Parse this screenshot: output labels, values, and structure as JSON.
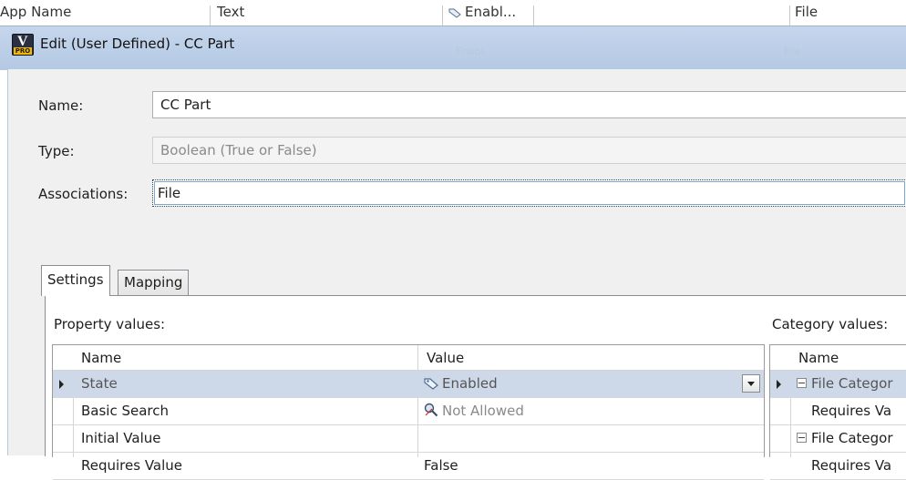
{
  "background_grid": {
    "col1": "App Name",
    "col2": "Text",
    "col3": "Enabl...",
    "col4": "File"
  },
  "dialog": {
    "title": "Edit (User Defined) - CC Part",
    "app_icon_text": "V",
    "app_icon_sub": "PRO"
  },
  "form": {
    "name_label": "Name:",
    "name_value": "CC Part",
    "type_label": "Type:",
    "type_value": "Boolean (True or False)",
    "associations_label": "Associations:",
    "associations_value": "File"
  },
  "tabs": [
    {
      "label": "Settings",
      "active": true
    },
    {
      "label": "Mapping",
      "active": false
    }
  ],
  "property_values": {
    "heading": "Property values:",
    "columns": [
      "Name",
      "Value"
    ],
    "rows": [
      {
        "name": "State",
        "value": "Enabled",
        "icon": "tag-icon",
        "selected": true,
        "dropdown": true
      },
      {
        "name": "Basic Search",
        "value": "Not Allowed",
        "icon": "search-disabled-icon",
        "muted": true
      },
      {
        "name": "Initial Value",
        "value": ""
      },
      {
        "name": "Requires Value",
        "value": "False"
      }
    ]
  },
  "category_values": {
    "heading": "Category values:",
    "columns": [
      "Name"
    ],
    "rows": [
      {
        "name": "File Categor",
        "group": true,
        "selected": true
      },
      {
        "name": "Requires Va",
        "group": false
      },
      {
        "name": "File Categor",
        "group": true
      },
      {
        "name": "Requires Va",
        "group": false
      }
    ]
  },
  "colors": {
    "titlebar": "#b9cde6",
    "selected_row": "#cdd9e8",
    "muted_text": "#8a8a8a"
  }
}
